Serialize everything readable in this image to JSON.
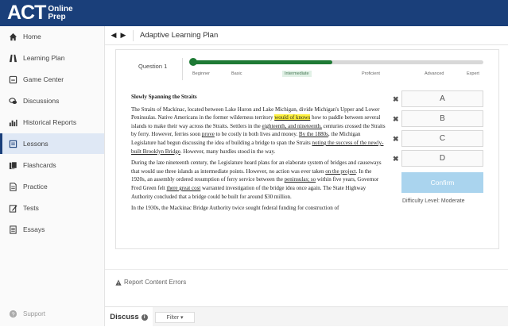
{
  "logo": {
    "brand": "ACT",
    "line1": "Online",
    "line2": "Prep"
  },
  "sidebar": {
    "items": [
      {
        "label": "Home",
        "icon": "home-icon"
      },
      {
        "label": "Learning Plan",
        "icon": "road-icon"
      },
      {
        "label": "Game Center",
        "icon": "gamepad-icon"
      },
      {
        "label": "Discussions",
        "icon": "chat-icon"
      },
      {
        "label": "Historical Reports",
        "icon": "bar-chart-icon"
      },
      {
        "label": "Lessons",
        "icon": "lesson-icon",
        "active": true
      },
      {
        "label": "Flashcards",
        "icon": "flashcards-icon"
      },
      {
        "label": "Practice",
        "icon": "document-icon"
      },
      {
        "label": "Tests",
        "icon": "pencil-icon"
      },
      {
        "label": "Essays",
        "icon": "essay-icon"
      }
    ],
    "support": "Support"
  },
  "breadcrumb": {
    "title": "Adaptive Learning Plan"
  },
  "question": {
    "label": "Question 1",
    "progress": 0.48,
    "levels": [
      "Beginner",
      "Basic",
      "Intermediate",
      "Proficient",
      "Advanced",
      "Expert"
    ],
    "current_level": "Intermediate"
  },
  "passage": {
    "title": "Slowly Spanning the Straits",
    "p1": {
      "a": "The Straits of Mackinac, located between Lake Huron and Lake Michigan, divide Michigan's Upper and Lower Peninsulas. Native Americans in the former wilderness territory ",
      "hl": "would of knows",
      "b": " how to paddle between several islands to make their way across the Straits. Settlers in the ",
      "u1": "eighteenth, and nineteenth,",
      "c": " centuries crossed the Straits by ferry. However, ferries soon ",
      "u2": "prove",
      "d": " to be costly in both lives and money. ",
      "u3": "By the 1880s",
      "e": ", the Michigan Legislature had begun discussing the idea of building a bridge to span the Straits ",
      "u4": "noting the success of the newly-built Brooklyn Bridge",
      "f": ". However, many hurdles stood in the way."
    },
    "p2": {
      "a": "During the late nineteenth century, the Legislature heard plans for an elaborate system of bridges and causeways that would use three islands as intermediate points. However, no action was ever taken ",
      "u1": "on the project",
      "b": ". In the 1920s, an assembly ordered resumption of ferry service between the ",
      "u2": "peninsulas; so",
      "c": " within five years, Governor Fred Green felt ",
      "u3": "there great cost",
      "d": " warranted investigation of the bridge idea once again. The State Highway Authority concluded that a bridge could be built for around $30 million."
    },
    "p3": "In the 1930s, the Mackinac Bridge Authority twice sought federal funding for construction of"
  },
  "answers": {
    "choices": [
      "A",
      "B",
      "C",
      "D"
    ],
    "confirm": "Confirm",
    "difficulty": "Difficulty Level: Moderate"
  },
  "report_link": "Report Content Errors",
  "bottom": {
    "discuss": "Discuss",
    "filter": "Filter ▾"
  },
  "colors": {
    "header": "#1a3f7a",
    "progress": "#1e7a35",
    "highlight": "#fff23d",
    "confirm": "#aad4ee"
  }
}
